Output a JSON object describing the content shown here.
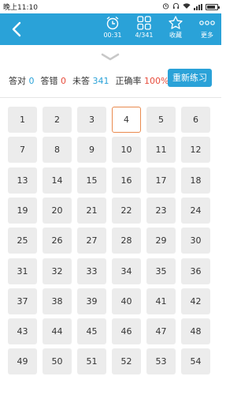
{
  "status_bar": {
    "time": "晚上11:10"
  },
  "header": {
    "timer": "00:31",
    "progress": "4/341",
    "favorite_label": "收藏",
    "more_label": "更多"
  },
  "stats": {
    "correct_label": "答对",
    "correct_value": "0",
    "wrong_label": "答错",
    "wrong_value": "0",
    "unanswered_label": "未答",
    "unanswered_value": "341",
    "rate_label": "正确率",
    "rate_value": "100%"
  },
  "retry_label": "重新练习",
  "questions": {
    "current": 4,
    "visible": [
      "1",
      "2",
      "3",
      "4",
      "5",
      "6",
      "7",
      "8",
      "9",
      "10",
      "11",
      "12",
      "13",
      "14",
      "15",
      "16",
      "17",
      "18",
      "19",
      "20",
      "21",
      "22",
      "23",
      "24",
      "25",
      "26",
      "27",
      "28",
      "29",
      "30",
      "31",
      "32",
      "33",
      "34",
      "35",
      "36",
      "37",
      "38",
      "39",
      "40",
      "41",
      "42",
      "43",
      "44",
      "45",
      "46",
      "47",
      "48",
      "49",
      "50",
      "51",
      "52",
      "53",
      "54"
    ]
  },
  "colors": {
    "accent": "#2aa2d8",
    "current_border": "#e98a4e",
    "red": "#e74c3c"
  }
}
